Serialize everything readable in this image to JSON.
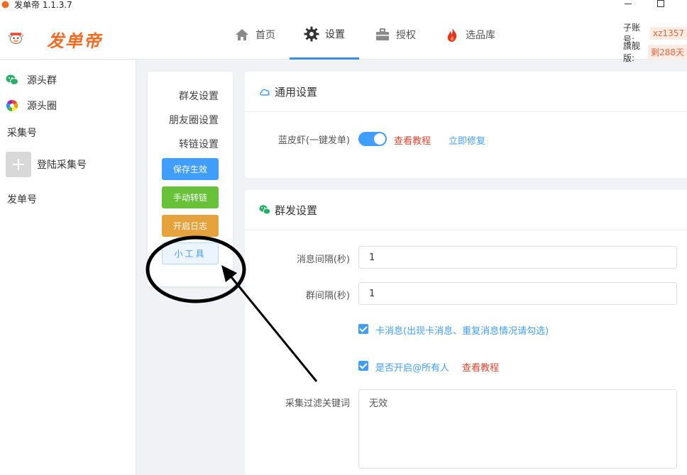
{
  "window": {
    "title": "发单帝 1.1.3.7"
  },
  "header": {
    "logo_text": "发单帝",
    "nav": [
      {
        "label": "首页",
        "icon": "home-icon",
        "active": false
      },
      {
        "label": "设置",
        "icon": "gear-icon",
        "active": true
      },
      {
        "label": "授权",
        "icon": "briefcase-icon",
        "active": false
      },
      {
        "label": "选品库",
        "icon": "fire-icon",
        "active": false
      }
    ],
    "sub_account_label": "子账号:",
    "sub_account_value": "xz1357",
    "vip_label": "旗舰版:",
    "vip_value": "剩288天"
  },
  "sidebar": {
    "items": [
      {
        "label": "源头群",
        "icon": "wechat-icon"
      },
      {
        "label": "源头圈",
        "icon": "moments-icon"
      }
    ],
    "collect_section": "采集号",
    "login_collect": "登陆采集号",
    "send_section": "发单号"
  },
  "subnav": {
    "links": [
      "群发设置",
      "朋友圈设置",
      "转链设置"
    ],
    "save_button": "保存生效",
    "manual_button": "手动转链",
    "log_button": "开启日志",
    "tools_button": "小工具"
  },
  "general": {
    "title": "通用设置",
    "switch_label": "蓝皮虾(一键发单)",
    "switch_on": true,
    "tutorial_link": "查看教程",
    "repair_link": "立即修复"
  },
  "group_send": {
    "title": "群发设置",
    "msg_interval_label": "消息间隔(秒)",
    "msg_interval_value": "1",
    "group_interval_label": "群间隔(秒)",
    "group_interval_value": "1",
    "stuck_check_label": "卡消息(出现卡消息、重复消息情况请勾选)",
    "at_all_label": "是否开启@所有人",
    "at_all_tutorial": "查看教程",
    "filter_label": "采集过滤关键词",
    "filter_value": "无效"
  },
  "colors": {
    "primary": "#409eff",
    "success": "#67c23a",
    "warning": "#e6a23c",
    "danger": "#e2462e",
    "brand": "#f26b22"
  }
}
